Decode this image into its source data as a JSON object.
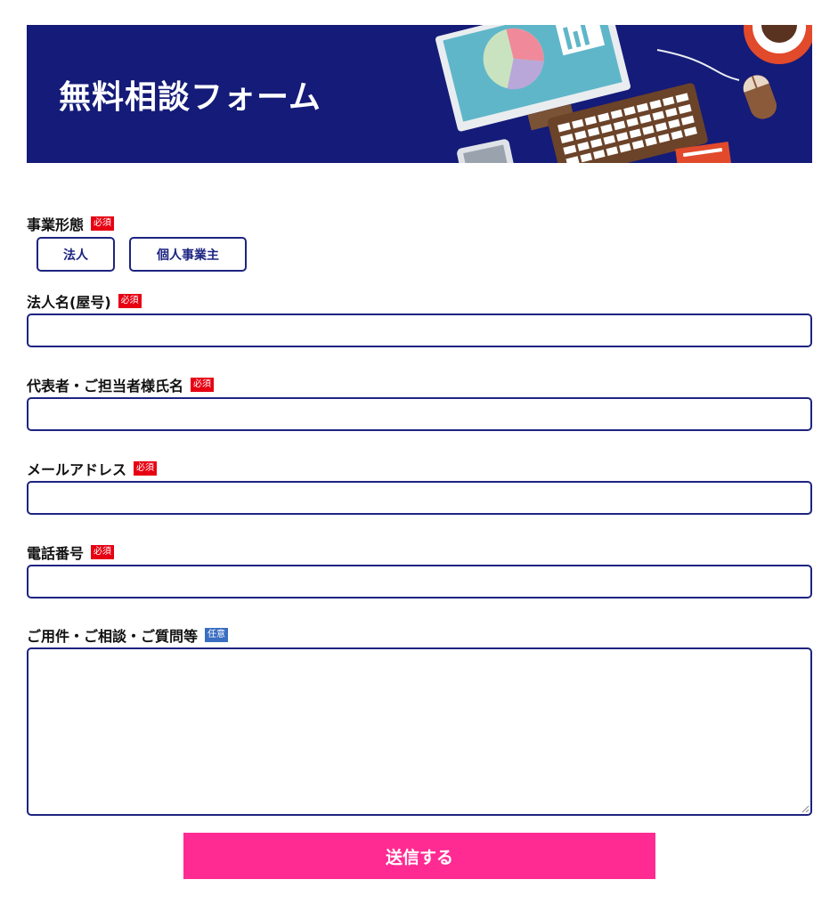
{
  "banner": {
    "title": "無料相談フォーム"
  },
  "badges": {
    "required": "必須",
    "optional": "任意"
  },
  "colors": {
    "navy": "#141b78",
    "border": "#1d2480",
    "required": "#e60012",
    "optional": "#3a6ec2",
    "submit": "#ff2a92"
  },
  "form": {
    "business_type": {
      "label": "事業形態",
      "options": [
        "法人",
        "個人事業主"
      ]
    },
    "company_name": {
      "label": "法人名(屋号)",
      "value": ""
    },
    "contact_name": {
      "label": "代表者・ご担当者様氏名",
      "value": ""
    },
    "email": {
      "label": "メールアドレス",
      "value": ""
    },
    "phone": {
      "label": "電話番号",
      "value": ""
    },
    "inquiry": {
      "label": "ご用件・ご相談・ご質問等",
      "value": ""
    }
  },
  "submit": {
    "label": "送信する"
  }
}
